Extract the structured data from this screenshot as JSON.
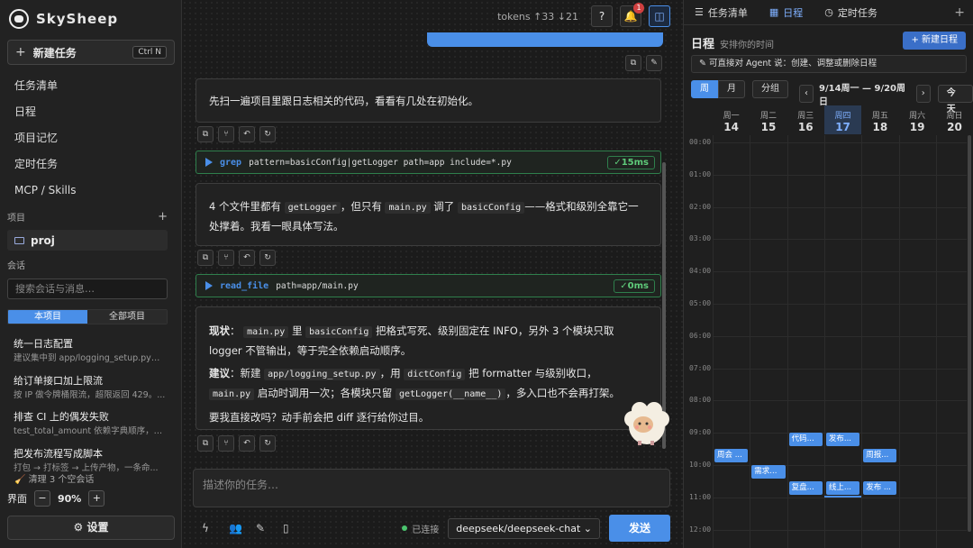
{
  "app": {
    "name": "SkySheep"
  },
  "sidebar": {
    "new_task_label": "新建任务",
    "new_task_shortcut": "Ctrl N",
    "nav": [
      "任务清单",
      "日程",
      "项目记忆",
      "定时任务",
      "MCP / Skills"
    ],
    "projects_label": "项目",
    "project_name": "proj",
    "conversations_label": "会话",
    "search_placeholder": "搜索会话与消息…",
    "filter": {
      "current": "本项目",
      "all": "全部项目"
    },
    "conversations": [
      {
        "title": "统一日志配置",
        "snippet": "建议集中到 app/logging_setup.py。..."
      },
      {
        "title": "给订单接口加上限流",
        "snippet": "按 IP 做令牌桶限流，超限返回 429。..."
      },
      {
        "title": "排查 CI 上的偶发失败",
        "snippet": "test_total_amount 依赖字典顺序，改..."
      },
      {
        "title": "把发布流程写成脚本",
        "snippet": "打包 → 打标签 → 上传产物，一条命..."
      }
    ],
    "clean_label": "清理 3 个空会话",
    "zoom": {
      "label": "界面",
      "value": "90%"
    },
    "settings_label": "⚙ 设置"
  },
  "main": {
    "tokens": "tokens ↑33 ↓21",
    "notif_count": "1",
    "user_msg": "先扫一遍项目里跟日志相关的代码，看看有几处在初始化。",
    "tool1": {
      "name": "grep",
      "args": "pattern=basicConfig|getLogger path=app include=*.py",
      "status": "✓15ms"
    },
    "reply1": {
      "p1": "4 个文件里都有",
      "c1": "getLogger",
      "p2": "，但只有",
      "c2": "main.py",
      "p3": "调了",
      "c4": "basicConfig",
      "p4": "——格式和级别全靠它一处撑着。我看一眼具体写法。"
    },
    "tool2": {
      "name": "read_file",
      "args": "path=app/main.py",
      "status": "✓0ms"
    },
    "reply2": {
      "l1_label": "现状",
      "l1_a": "：",
      "l1_c1": "main.py",
      "l1_b": "里",
      "l1_c2": "basicConfig",
      "l1_c": "把格式写死、级别固定在 INFO，另外 3 个模块只取 logger 不管输出，等于完全依赖启动顺序。",
      "l2_label": "建议",
      "l2_a": "：新建",
      "l2_c1": "app/logging_setup.py",
      "l2_b": "，用",
      "l2_c2": "dictConfig",
      "l2_c": "把 formatter 与级别收口，",
      "l2_c3": "main.py",
      "l2_d": "启动时调用一次；各模块只留",
      "l2_c4": "getLogger(__name__)",
      "l2_e": "，多入口也不会再打架。",
      "l3": "要我直接改吗？动手前会把 diff 逐行给你过目。"
    },
    "input_placeholder": "描述你的任务…",
    "connection": "已连接",
    "model": "deepseek/deepseek-chat",
    "send_label": "发送"
  },
  "right": {
    "tabs": [
      "任务清单",
      "日程",
      "定时任务"
    ],
    "title": "日程",
    "subtitle": "安排你的时间",
    "new_event": "+ 新建日程",
    "hint": "✎ 可直接对 Agent 说：创建、调整或删除日程",
    "views": [
      "周",
      "月",
      "分组"
    ],
    "range": "9/14周一 — 9/20周日",
    "today": "今天",
    "days": [
      {
        "wd": "周一",
        "dn": "14"
      },
      {
        "wd": "周二",
        "dn": "15"
      },
      {
        "wd": "周三",
        "dn": "16"
      },
      {
        "wd": "周四",
        "dn": "17"
      },
      {
        "wd": "周五",
        "dn": "18"
      },
      {
        "wd": "周六",
        "dn": "19"
      },
      {
        "wd": "周日",
        "dn": "20"
      }
    ],
    "hours": [
      "00:00",
      "01:00",
      "02:00",
      "03:00",
      "04:00",
      "05:00",
      "06:00",
      "07:00",
      "08:00",
      "09:00",
      "10:00",
      "11:00",
      "12:00"
    ],
    "events": [
      {
        "day": 2,
        "start": 9.0,
        "title": "代码..."
      },
      {
        "day": 3,
        "start": 9.0,
        "title": "发布..."
      },
      {
        "day": 0,
        "start": 9.5,
        "title": "周会 ..."
      },
      {
        "day": 4,
        "start": 9.5,
        "title": "周报..."
      },
      {
        "day": 1,
        "start": 10.0,
        "title": "需求..."
      },
      {
        "day": 2,
        "start": 10.5,
        "title": "复盘..."
      },
      {
        "day": 3,
        "start": 10.5,
        "title": "线上..."
      },
      {
        "day": 4,
        "start": 10.5,
        "title": "发布 ..."
      }
    ],
    "now": {
      "day": 3,
      "hour": 10.95
    },
    "colors": {
      "accent": "#4a8fe8",
      "ok": "#5ecb7a"
    }
  }
}
